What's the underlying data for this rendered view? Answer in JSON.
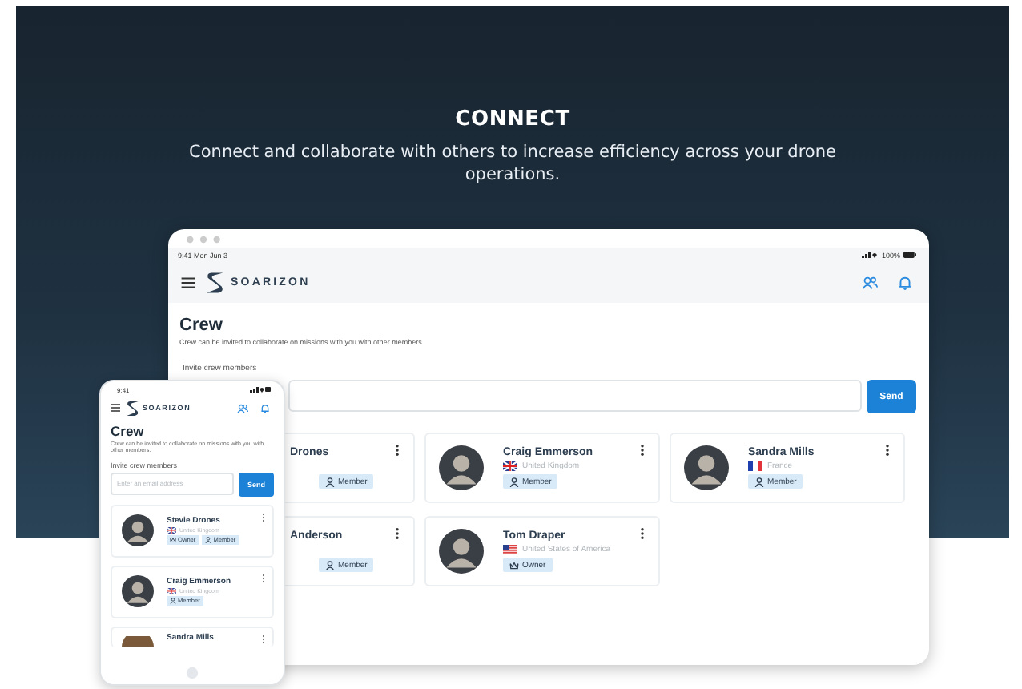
{
  "banner": {
    "title": "CONNECT",
    "subtitle": "Connect and collaborate with others to increase efficiency across your drone operations."
  },
  "tablet": {
    "status_time": "9:41  Mon Jun 3",
    "battery": "100%",
    "brand": "SOARIZON",
    "page_title": "Crew",
    "description": "Crew can be invited to collaborate on missions with you with other members",
    "invite_label": "Invite crew members",
    "send": "Send",
    "cards": [
      {
        "kind": "partial",
        "name": "Drones",
        "badges": [
          {
            "kind": "member",
            "label": "Member"
          }
        ]
      },
      {
        "kind": "full",
        "name": "Craig Emmerson",
        "flag": {
          "kind": "uk"
        },
        "country": "United Kingdom",
        "badges": [
          {
            "kind": "member",
            "label": "Member"
          }
        ]
      },
      {
        "kind": "full",
        "name": "Sandra Mills",
        "flag": {
          "kind": "fr"
        },
        "country": "France",
        "badges": [
          {
            "kind": "member",
            "label": "Member"
          }
        ]
      },
      {
        "kind": "partial",
        "name": "Anderson",
        "badges": [
          {
            "kind": "member",
            "label": "Member"
          }
        ]
      },
      {
        "kind": "full",
        "name": "Tom Draper",
        "flag": {
          "kind": "us"
        },
        "country": "United States of America",
        "badges": [
          {
            "kind": "owner",
            "label": "Owner"
          }
        ]
      }
    ]
  },
  "phone": {
    "status_time": "9:41",
    "brand": "SOARIZON",
    "page_title": "Crew",
    "description": "Crew can be invited to collaborate on missions with you with other members.",
    "invite_label": "Invite crew members",
    "email": {
      "placeholder": "Enter an email address"
    },
    "send": "Send",
    "cards": [
      {
        "kind": "full",
        "name": "Stevie Drones",
        "flag": {
          "kind": "uk"
        },
        "country": "United Kingdom",
        "badges": [
          {
            "kind": "owner",
            "label": "Owner"
          },
          {
            "kind": "member",
            "label": "Member"
          }
        ]
      },
      {
        "kind": "full",
        "name": "Craig Emmerson",
        "flag": {
          "kind": "uk"
        },
        "country": "United Kingdom",
        "badges": [
          {
            "kind": "member",
            "label": "Member"
          }
        ]
      },
      {
        "kind": "cut",
        "name": "Sandra Mills"
      }
    ]
  }
}
